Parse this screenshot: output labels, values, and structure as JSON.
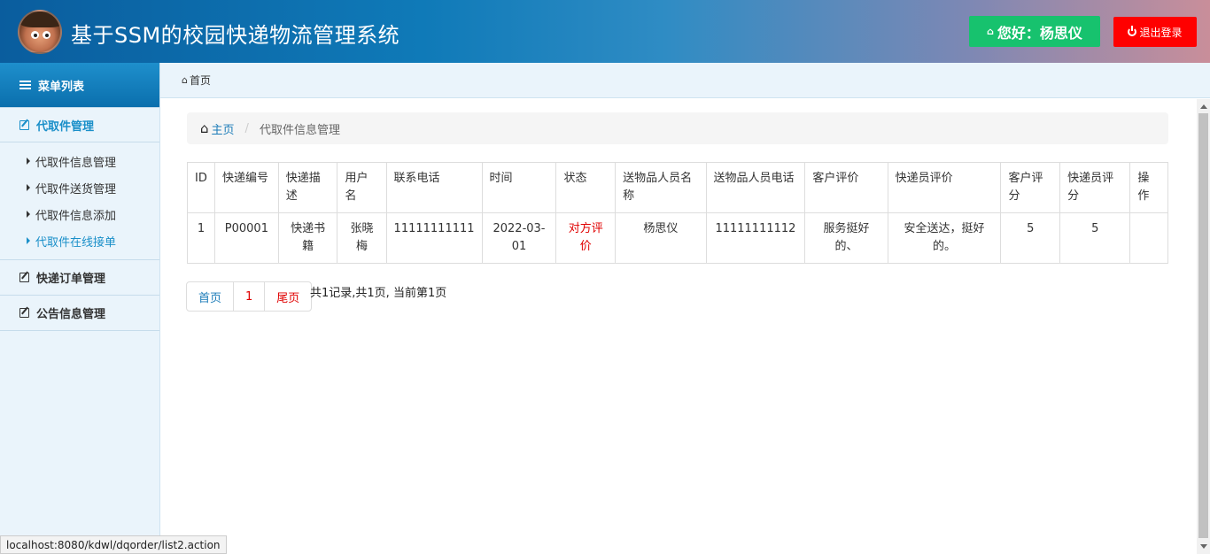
{
  "header": {
    "title": "基于SSM的校园快递物流管理系统",
    "greeting": "您好：杨思仪",
    "logout_label": "退出登录",
    "colors": {
      "greet_bg": "#17c26e",
      "logout_bg": "#ff0000"
    }
  },
  "sidebar": {
    "heading": "菜单列表",
    "groups": [
      {
        "label": "代取件管理",
        "items": [
          "代取件信息管理",
          "代取件送货管理",
          "代取件信息添加",
          "代取件在线接单"
        ]
      },
      {
        "label": "快递订单管理"
      },
      {
        "label": "公告信息管理"
      }
    ],
    "active_item": "代取件在线接单"
  },
  "topbar": {
    "label": "首页"
  },
  "breadcrumb": {
    "home": "主页",
    "current": "代取件信息管理"
  },
  "table": {
    "headers": [
      "ID",
      "快递编号",
      "快递描述",
      "用户名",
      "联系电话",
      "时间",
      "状态",
      "送物品人员名称",
      "送物品人员电话",
      "客户评价",
      "快递员评价",
      "客户评分",
      "快递员评分",
      "操作"
    ],
    "rows": [
      [
        "1",
        "P00001",
        "快递书籍",
        "张晓梅",
        "11111111111",
        "2022-03-01",
        "对方评价",
        "杨思仪",
        "11111111112",
        "服务挺好的、",
        "安全送达，挺好的。",
        "5",
        "5",
        ""
      ]
    ]
  },
  "pagination": {
    "first": "首页",
    "current": "1",
    "last": "尾页",
    "info": "共1记录,共1页, 当前第1页"
  },
  "status_bar": {
    "url": "localhost:8080/kdwl/dqorder/list2.action"
  }
}
